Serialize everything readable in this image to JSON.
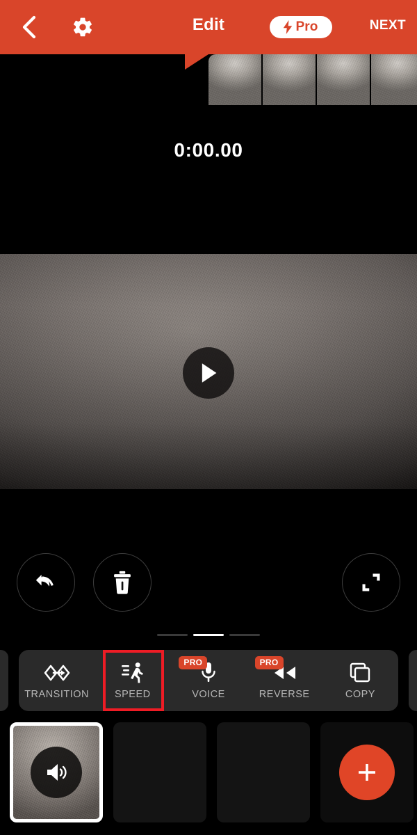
{
  "header": {
    "back_icon": "chevron-left-icon",
    "settings_icon": "gear-icon",
    "title": "Edit",
    "pro_label": "Pro",
    "pro_icon": "lightning-bolt-icon",
    "next_label": "NEXT",
    "background_color": "#D9452A"
  },
  "preview": {
    "timecode": "0:00.00",
    "play_icon": "play-icon"
  },
  "actions": [
    {
      "name": "undo",
      "icon": "undo-arrow-icon"
    },
    {
      "name": "delete",
      "icon": "trash-icon"
    },
    {
      "name": "expand",
      "icon": "expand-corners-icon"
    }
  ],
  "pager": {
    "count": 3,
    "active_index": 1
  },
  "toolbar": {
    "selected_index": 1,
    "selection_color": "#EE1C25",
    "pro_badge_color": "#D9452A",
    "tools": [
      {
        "label": "TRANSITION",
        "icon": "transition-icon",
        "pro": false
      },
      {
        "label": "SPEED",
        "icon": "running-person-icon",
        "pro": false
      },
      {
        "label": "VOICE",
        "icon": "microphone-icon",
        "pro": true,
        "pro_label": "PRO"
      },
      {
        "label": "REVERSE",
        "icon": "rewind-icon",
        "pro": true,
        "pro_label": "PRO"
      },
      {
        "label": "COPY",
        "icon": "copy-icon",
        "pro": false
      }
    ]
  },
  "track": {
    "clips": [
      {
        "type": "video",
        "selected": true,
        "overlay_icon": "speaker-icon"
      },
      {
        "type": "empty",
        "selected": false
      },
      {
        "type": "empty",
        "selected": false
      }
    ],
    "add_label": "+",
    "add_icon": "plus-icon",
    "add_color": "#E04527"
  }
}
